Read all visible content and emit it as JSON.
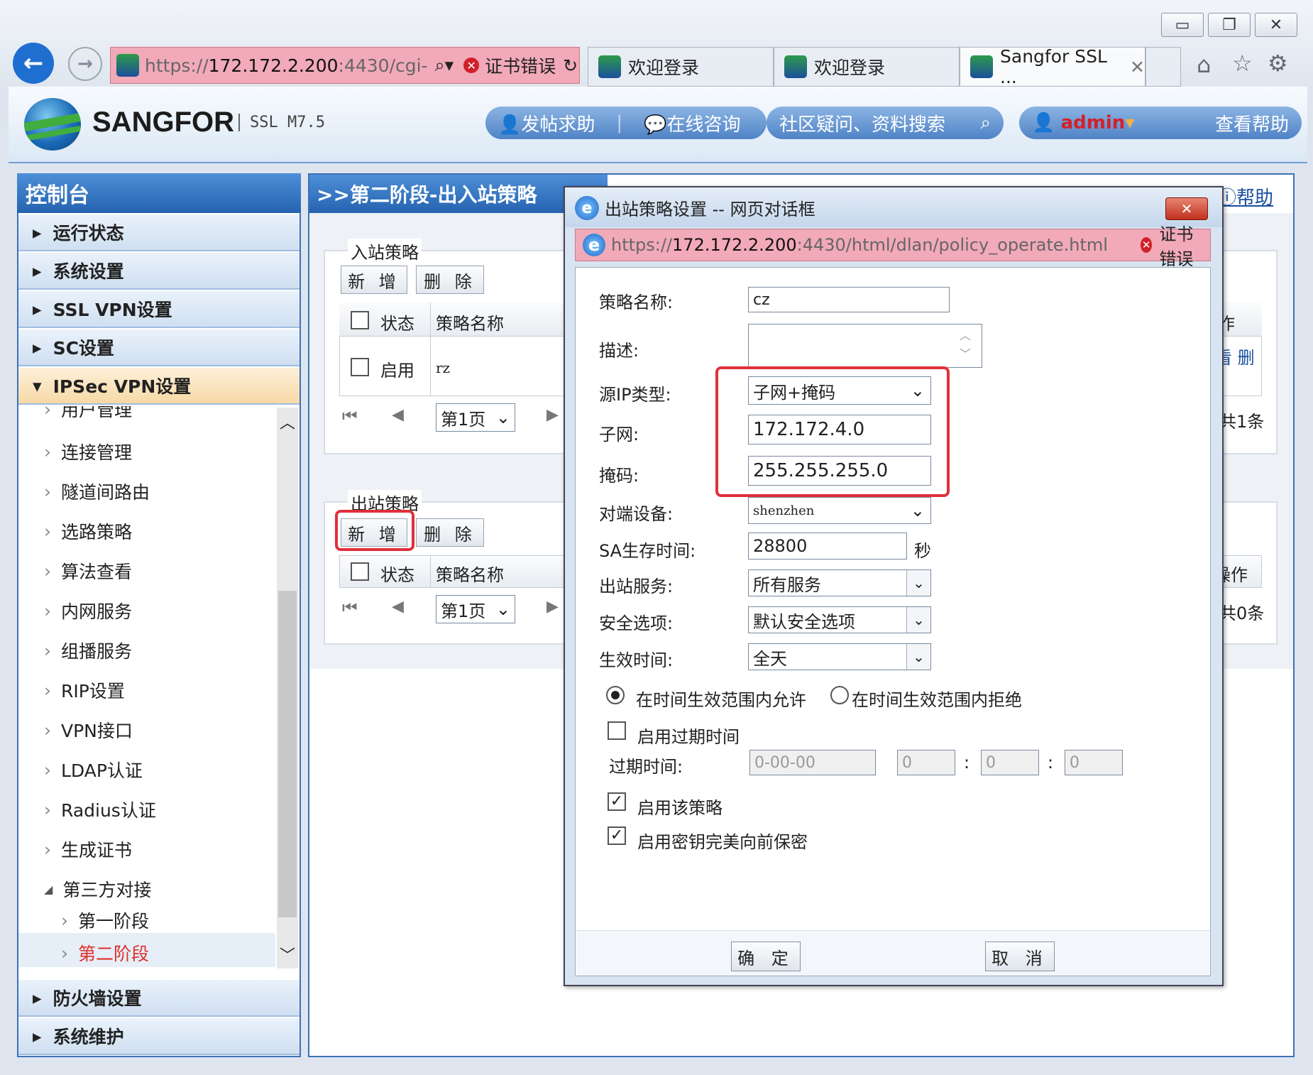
{
  "browser": {
    "url_prefix": "https://",
    "url_host": "172.172.2.200",
    "url_rest": ":4430/cgi-",
    "cert_error": "证书错误",
    "tabs": [
      {
        "label": "欢迎登录"
      },
      {
        "label": "欢迎登录"
      },
      {
        "label": "Sangfor SSL ..."
      }
    ]
  },
  "header": {
    "brand": "SANGFOR",
    "version": "SSL M7.5",
    "nav": [
      "发帖求助",
      "在线咨询"
    ],
    "search_placeholder": "社区疑问、资料搜索",
    "user": "admin",
    "help": "查看帮助"
  },
  "sidebar": {
    "title": "控制台",
    "top_items": [
      "运行状态",
      "系统设置",
      "SSL VPN设置",
      "SC设置",
      "IPSec VPN设置"
    ],
    "sub_items": [
      "用户管理",
      "连接管理",
      "隧道间路由",
      "选路策略",
      "算法查看",
      "内网服务",
      "组播服务",
      "RIP设置",
      "VPN接口",
      "LDAP认证",
      "Radius认证",
      "生成证书"
    ],
    "group_label": "第三方对接",
    "group_children": [
      "第一阶段",
      "第二阶段"
    ],
    "bottom_items": [
      "防火墙设置",
      "系统维护"
    ]
  },
  "main": {
    "title": ">>第二阶段-出入站策略",
    "help_link": "帮助",
    "inbound": {
      "legend": "入站策略",
      "add": "新 增",
      "delete": "删 除",
      "col_status": "状态",
      "col_name": "策略名称",
      "col_op": "作",
      "row_status": "启用",
      "row_name": "rz",
      "row_ops": "看 删",
      "page": "第1页",
      "total": "共1条"
    },
    "outbound": {
      "legend": "出站策略",
      "add": "新 增",
      "delete": "删 除",
      "col_status": "状态",
      "col_name": "策略名称",
      "col_op": "操作",
      "page": "第1页",
      "total": "共0条"
    }
  },
  "dialog": {
    "title": "出站策略设置 -- 网页对话框",
    "url_prefix": "https://",
    "url_host": "172.172.2.200",
    "url_rest": ":4430/html/dlan/policy_operate.html",
    "cert_error": "证书错误",
    "labels": {
      "name": "策略名称:",
      "desc": "描述:",
      "src_type": "源IP类型:",
      "subnet": "子网:",
      "mask": "掩码:",
      "peer": "对端设备:",
      "sa": "SA生存时间:",
      "sa_unit": "秒",
      "service": "出站服务:",
      "security": "安全选项:",
      "time": "生效时间:",
      "expire": "过期时间:"
    },
    "values": {
      "name": "cz",
      "src_type": "子网+掩码",
      "subnet": "172.172.4.0",
      "mask": "255.255.255.0",
      "peer": "shenzhen",
      "sa": "28800",
      "service": "所有服务",
      "security": "默认安全选项",
      "time": "全天",
      "expire_date": "0-00-00",
      "expire_h": "0",
      "expire_m": "0",
      "expire_s": "0"
    },
    "radio_allow": "在时间生效范围内允许",
    "radio_deny": "在时间生效范围内拒绝",
    "enable_expire": "启用过期时间",
    "enable_policy": "启用该策略",
    "enable_pfs": "启用密钥完美向前保密",
    "ok": "确 定",
    "cancel": "取 消"
  },
  "colors": {
    "accent": "#2563b0",
    "highlight_red": "#e0303c",
    "cert_error_bg": "#f2a9b8",
    "admin_text": "#d4202a"
  }
}
